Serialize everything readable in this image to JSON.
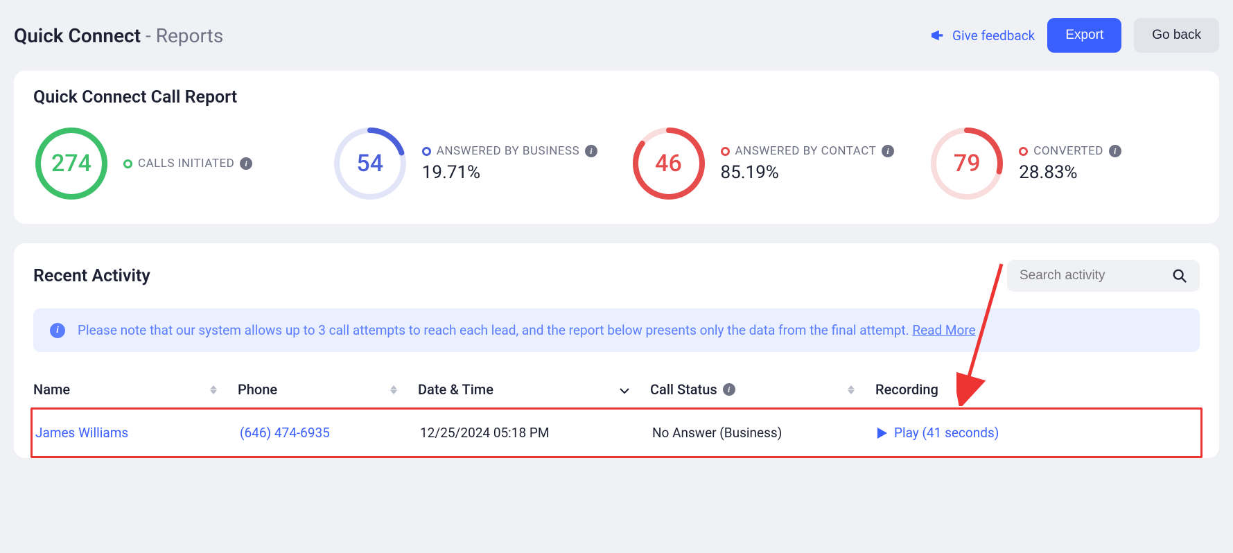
{
  "header": {
    "title": "Quick Connect",
    "subtitle": " - Reports",
    "feedback_label": "Give feedback",
    "export_label": "Export",
    "goback_label": "Go back"
  },
  "report": {
    "title": "Quick Connect Call Report",
    "stats": [
      {
        "value": "274",
        "label": "CALLS INITIATED",
        "pct": "",
        "color": "#3cc06a",
        "fill_pct": 100,
        "track": "#d9f2e3"
      },
      {
        "value": "54",
        "label": "ANSWERED BY BUSINESS",
        "pct": "19.71%",
        "color": "#4a5fd9",
        "fill_pct": 19.71,
        "track": "#e1e5f7"
      },
      {
        "value": "46",
        "label": "ANSWERED BY CONTACT",
        "pct": "85.19%",
        "color": "#e64c4c",
        "fill_pct": 85.19,
        "track": "#f9dcdc"
      },
      {
        "value": "79",
        "label": "CONVERTED",
        "pct": "28.83%",
        "color": "#e64c4c",
        "fill_pct": 28.83,
        "track": "#f9dcdc"
      }
    ]
  },
  "recent": {
    "title": "Recent Activity",
    "search_placeholder": "Search activity",
    "notice_text": "Please note that our system allows up to 3 call attempts to reach each lead, and the report below presents only the data from the final attempt. ",
    "notice_link": "Read More",
    "columns": {
      "name": "Name",
      "phone": "Phone",
      "date": "Date & Time",
      "status": "Call Status",
      "recording": "Recording"
    },
    "row": {
      "name": "James Williams",
      "phone": "(646) 474-6935",
      "date": "12/25/2024 05:18 PM",
      "status": "No Answer (Business)",
      "play": "Play (41 seconds)"
    }
  }
}
